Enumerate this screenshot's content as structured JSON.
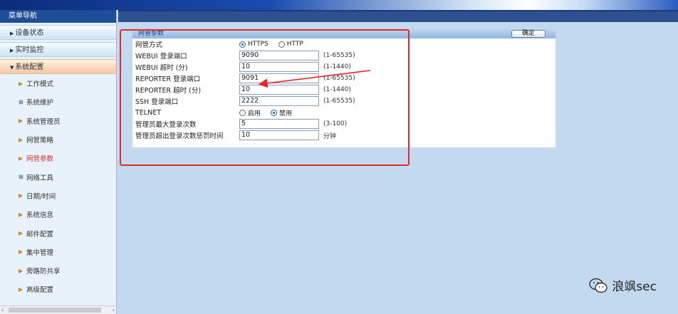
{
  "sidebar": {
    "title": "菜单导航",
    "sections": [
      {
        "label": "设备状态",
        "arrow": "▶"
      },
      {
        "label": "实时监控",
        "arrow": "▶"
      },
      {
        "label": "系统配置",
        "arrow": "▼"
      }
    ],
    "items": [
      {
        "label": "工作模式",
        "marker": "▶"
      },
      {
        "label": "系统维护",
        "marker": "⊞"
      },
      {
        "label": "系统管理员",
        "marker": "▶"
      },
      {
        "label": "网管策略",
        "marker": "▶"
      },
      {
        "label": "网管参数",
        "marker": "▶"
      },
      {
        "label": "网络工具",
        "marker": "⊞"
      },
      {
        "label": "日期/时间",
        "marker": "▶"
      },
      {
        "label": "系统信息",
        "marker": "▶"
      },
      {
        "label": "邮件配置",
        "marker": "▶"
      },
      {
        "label": "集中管理",
        "marker": "▶"
      },
      {
        "label": "旁路防共享",
        "marker": "▶"
      },
      {
        "label": "高级配置",
        "marker": "▶"
      }
    ]
  },
  "panel": {
    "title": "网管参数",
    "ok_label": "确定",
    "rows": [
      {
        "label": "网管方式",
        "type": "radio",
        "options": [
          "HTTPS",
          "HTTP"
        ],
        "selected": 0
      },
      {
        "label": "WEBUI 登录端口",
        "type": "input",
        "value": "9090",
        "hint": "(1-65535)"
      },
      {
        "label": "WEBUI 超时 (分)",
        "type": "input",
        "value": "10",
        "hint": "(1-1440)"
      },
      {
        "label": "REPORTER 登录端口",
        "type": "input",
        "value": "9091",
        "hint": "(1-65535)"
      },
      {
        "label": "REPORTER 超时 (分)",
        "type": "input",
        "value": "10",
        "hint": "(1-1440)"
      },
      {
        "label": "SSH 登录端口",
        "type": "input",
        "value": "2222",
        "hint": "(1-65535)"
      },
      {
        "label": "TELNET",
        "type": "radio",
        "options": [
          "启用",
          "禁用"
        ],
        "selected": 1
      },
      {
        "label": "管理员最大登录次数",
        "type": "input",
        "value": "5",
        "hint": "(3-100)"
      },
      {
        "label": "管理员超出登录次数惩罚时间",
        "type": "input",
        "value": "10",
        "hint": "分钟"
      }
    ]
  },
  "watermark": {
    "text": "浪飒sec"
  },
  "colors": {
    "annotation_red": "#e8262a",
    "sidebar_header": "#1f4e98",
    "page_bg": "#c3d9f0"
  }
}
